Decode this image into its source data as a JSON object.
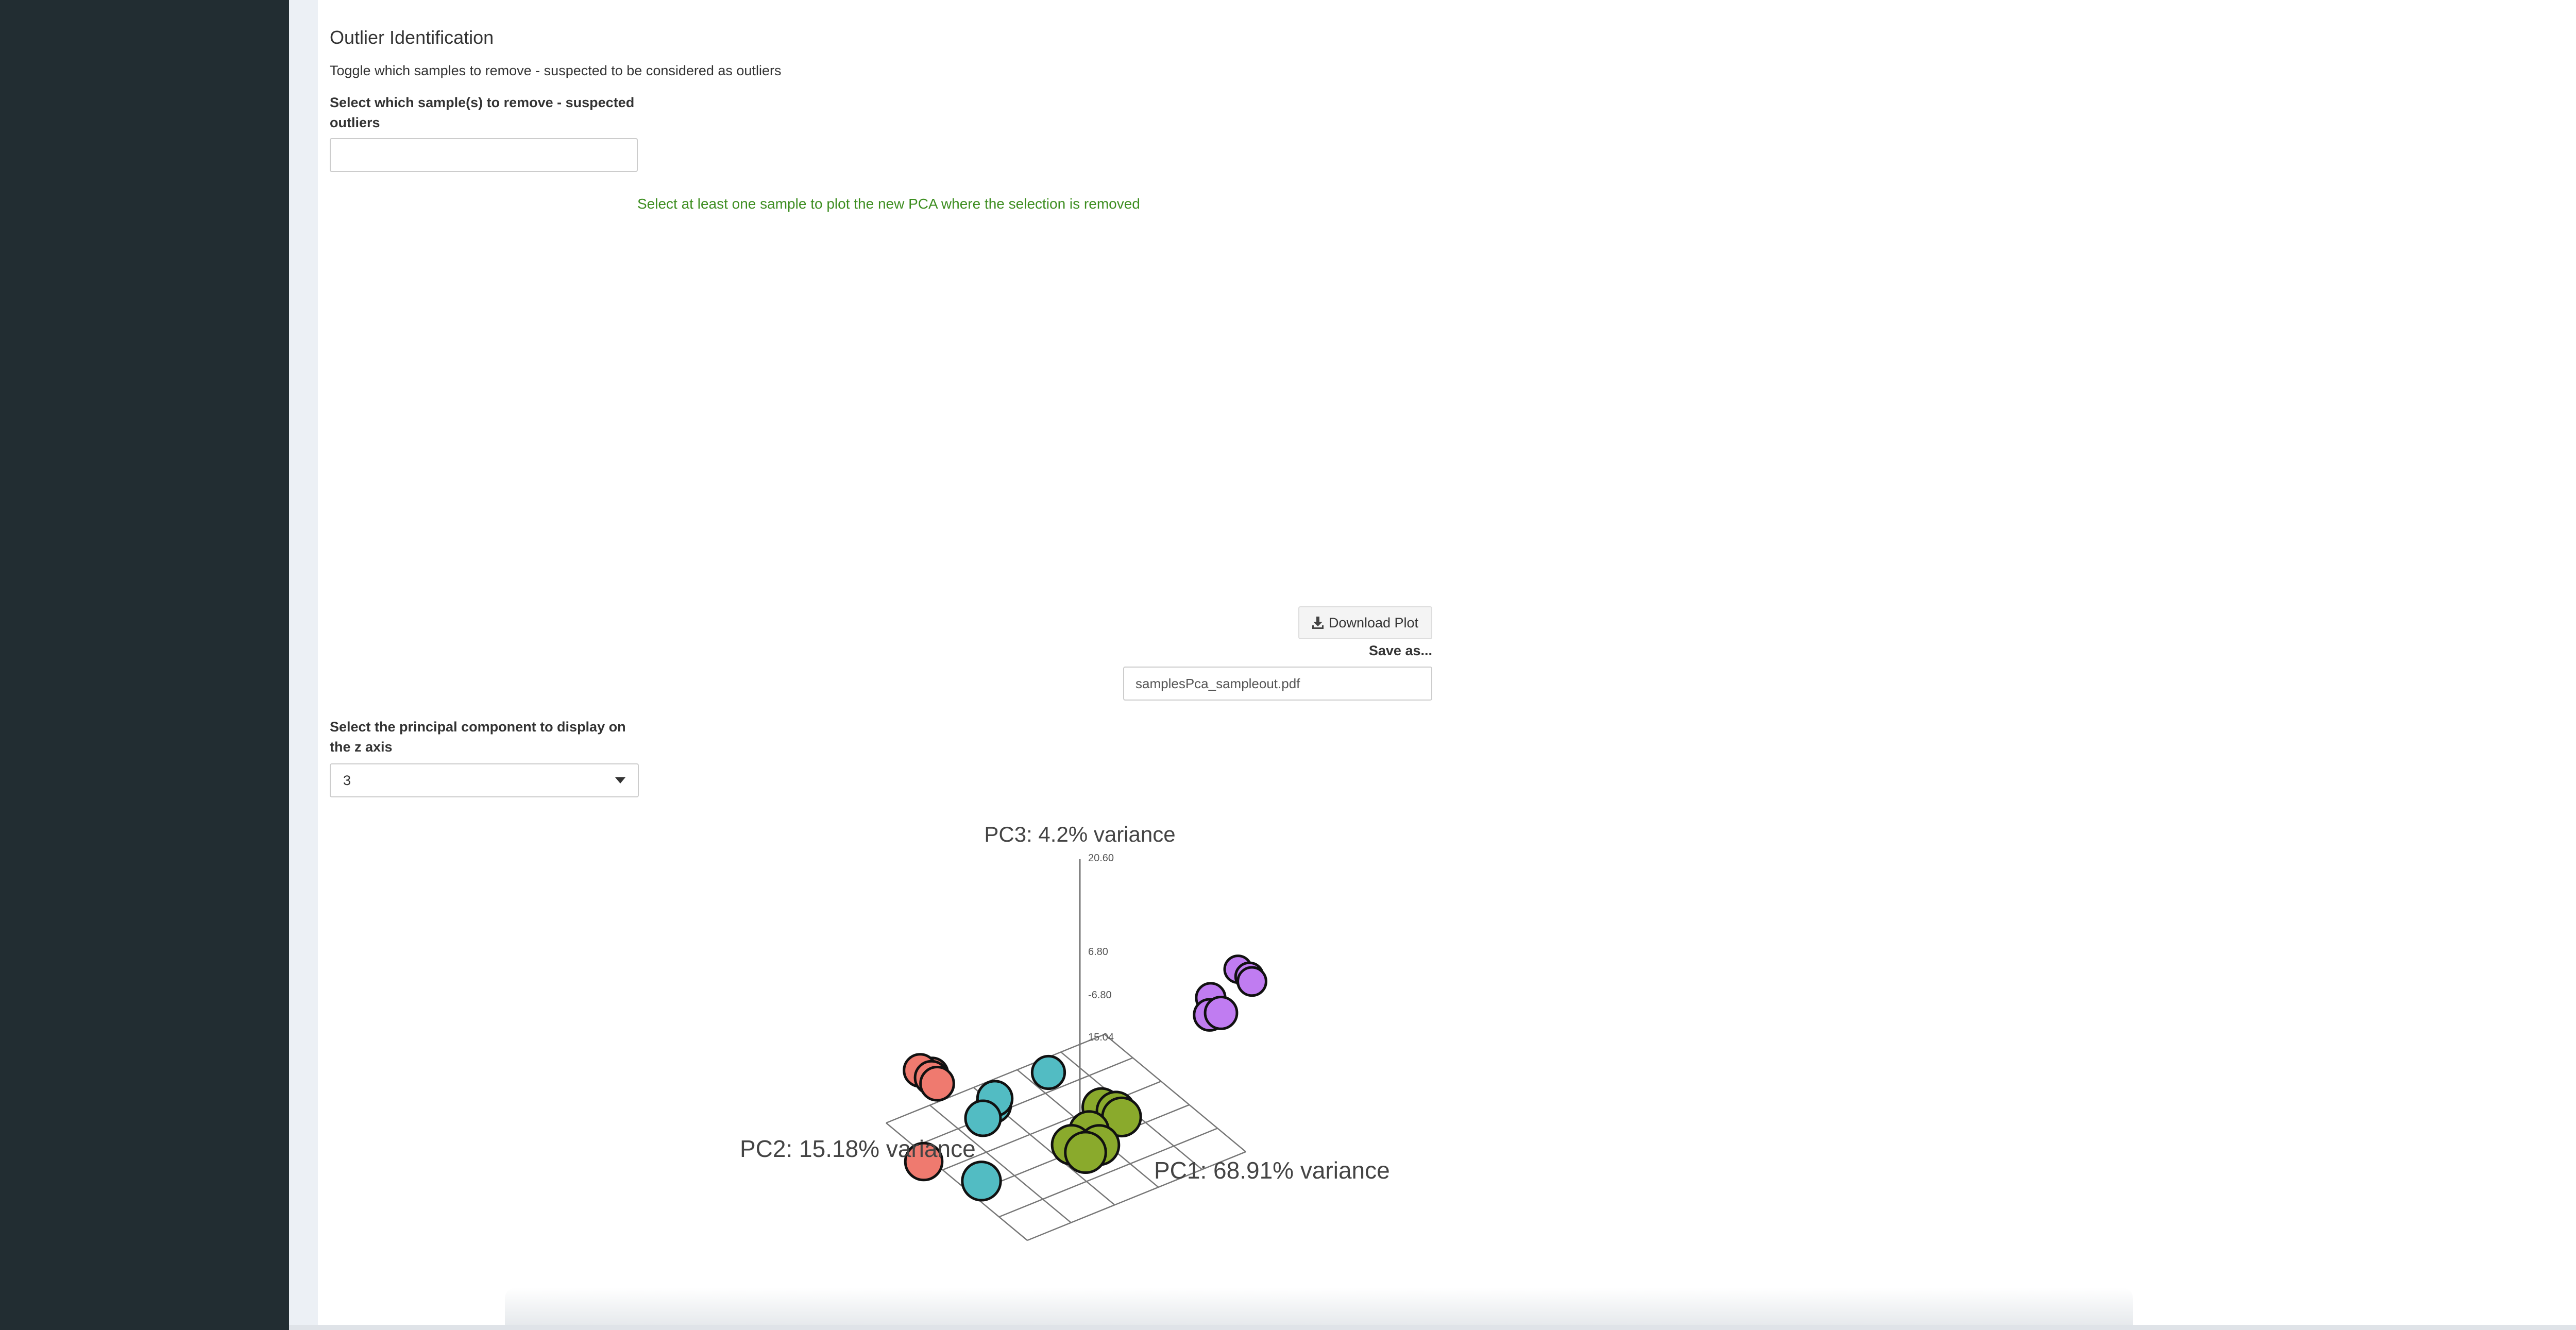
{
  "outlier_section": {
    "title": "Outlier Identification",
    "description": "Toggle which samples to remove - suspected to be considered as outliers",
    "sample_select_label": "Select which sample(s) to remove - suspected outliers",
    "sample_select_value": "",
    "validation_message": "Select at least one sample to plot the new PCA where the selection is removed"
  },
  "download": {
    "button_label": "Download Plot",
    "save_as_label": "Save as...",
    "filename_value": "samplesPca_sampleout.pdf"
  },
  "pc_select": {
    "label": "Select the principal component to display on the z axis",
    "value": "3"
  },
  "icons": {
    "download": "download-icon",
    "dropdown": "caret-down-icon"
  },
  "colors": {
    "sidebar": "#222d32",
    "validation_text": "#3c8d1f",
    "group_1": "#ef7a6f",
    "group_2": "#52bcc3",
    "group_3": "#8aaa2c",
    "group_4": "#c07cf1"
  },
  "chart_data": {
    "type": "scatter",
    "projection": "3d",
    "axis_titles": {
      "x": "PC1: 68.91% variance",
      "y": "PC2: 15.18% variance",
      "z": "PC3: 4.2% variance"
    },
    "z_tick_labels": [
      "20.60",
      "6.80",
      "-6.80",
      "15.04"
    ],
    "grid": true,
    "legend": "none",
    "series": [
      {
        "color": "#ef7a6f",
        "points": [
          [
            -40,
            5,
            10
          ],
          [
            -38,
            6,
            9
          ],
          [
            -36,
            3,
            7
          ],
          [
            -34,
            2,
            5
          ],
          [
            -30,
            -8,
            -15
          ]
        ]
      },
      {
        "color": "#52bcc3",
        "points": [
          [
            -10,
            4,
            2
          ],
          [
            -18,
            -2,
            -3
          ],
          [
            -19,
            -1,
            -4
          ],
          [
            -20,
            -3,
            -7
          ],
          [
            -14,
            -12,
            -24
          ]
        ]
      },
      {
        "color": "#8aaa2c",
        "points": [
          [
            12,
            -10,
            -14
          ],
          [
            16,
            -11,
            -16
          ],
          [
            18,
            -12,
            -18
          ],
          [
            12,
            -14,
            -20
          ],
          [
            8,
            -14,
            -22
          ],
          [
            15,
            -15,
            -24
          ],
          [
            11,
            -12,
            -21
          ],
          [
            14,
            -18,
            -26
          ]
        ]
      },
      {
        "color": "#c07cf1",
        "points": [
          [
            22,
            20,
            20
          ],
          [
            26,
            18,
            17
          ],
          [
            28,
            16,
            15
          ],
          [
            20,
            14,
            13
          ],
          [
            28,
            6,
            6
          ],
          [
            24,
            8,
            7
          ]
        ]
      }
    ]
  }
}
